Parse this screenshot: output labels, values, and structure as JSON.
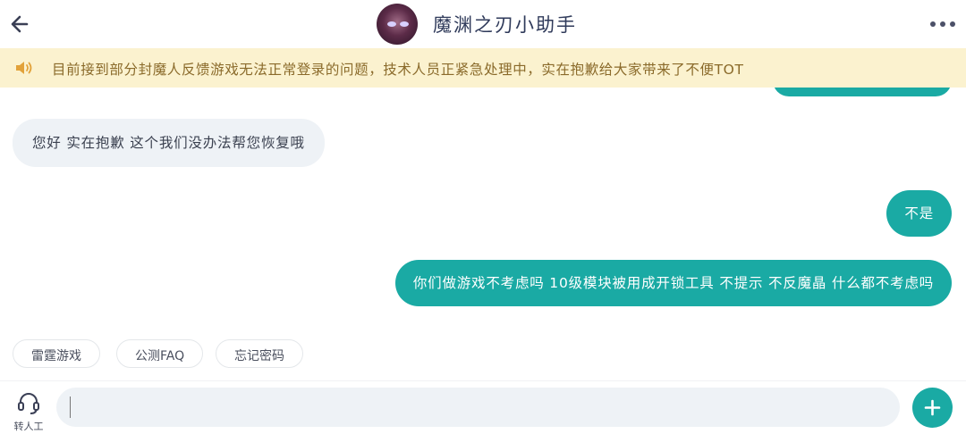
{
  "header": {
    "title": "魔渊之刃小助手"
  },
  "notice": {
    "text": "目前接到部分封魔人反馈游戏无法正常登录的问题，技术人员正紧急处理中，实在抱歉给大家带来了不便TOT"
  },
  "messages": [
    {
      "side": "left",
      "text": "您好 实在抱歉 这个我们没办法帮您恢复哦"
    },
    {
      "side": "right",
      "text": "不是"
    },
    {
      "side": "right",
      "text": "你们做游戏不考虑吗 10级模块被用成开锁工具 不提示 不反魔晶 什么都不考虑吗"
    }
  ],
  "quick_replies": [
    "雷霆游戏",
    "公测FAQ",
    "忘记密码"
  ],
  "bottom": {
    "agent_label": "转人工",
    "input_value": ""
  },
  "colors": {
    "accent": "#1aaaa4",
    "notice_bg": "#fbf2cf",
    "notice_text": "#8a6a2a",
    "bubble_left_bg": "#eef2f6"
  },
  "icons": {
    "back": "arrow-left-icon",
    "more": "more-dots-icon",
    "notice": "speaker-icon",
    "agent": "headset-icon",
    "plus": "plus-icon"
  }
}
